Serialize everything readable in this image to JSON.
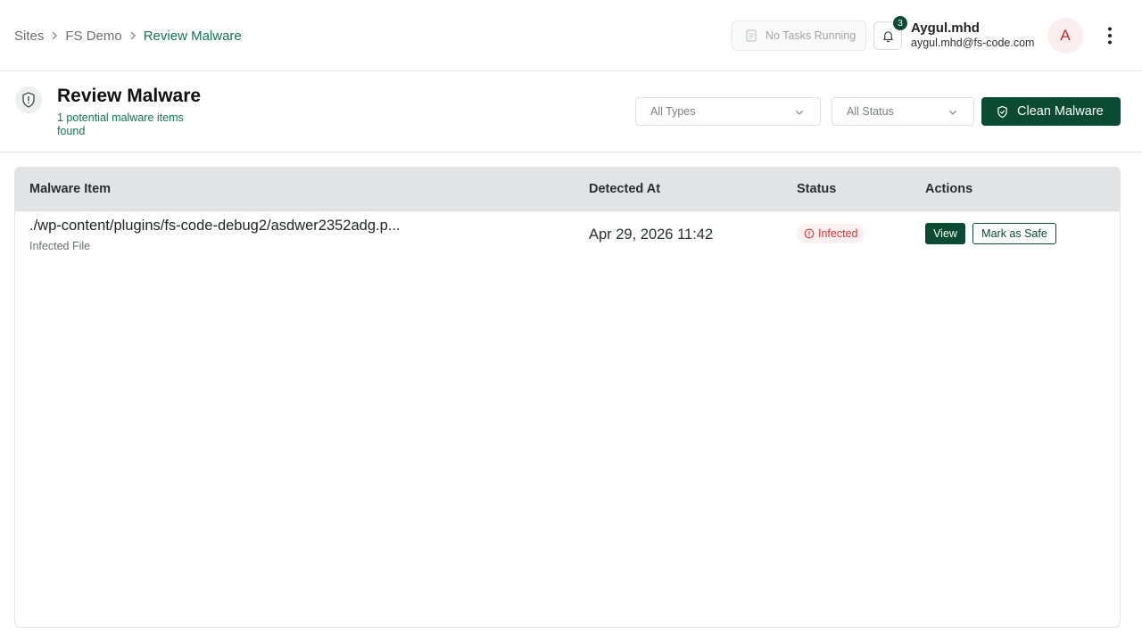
{
  "breadcrumb": {
    "items": [
      {
        "label": "Sites"
      },
      {
        "label": "FS Demo"
      },
      {
        "label": "Review Malware"
      }
    ]
  },
  "header": {
    "tasks_label": "No Tasks Running",
    "notification_count": "3",
    "user_name": "Aygul.mhd",
    "user_email": "aygul.mhd@fs-code.com",
    "avatar_initial": "A"
  },
  "page": {
    "title": "Review Malware",
    "subtitle": "1 potential malware items found",
    "type_filter": "All Types",
    "status_filter": "All Status",
    "clean_label": "Clean Malware"
  },
  "table": {
    "columns": [
      "Malware Item",
      "Detected At",
      "Status",
      "Actions"
    ],
    "rows": [
      {
        "path": "./wp-content/plugins/fs-code-debug2/asdwer2352adg.p...",
        "type": "Infected File",
        "detected_at": "Apr 29, 2026 11:42",
        "status": "Infected",
        "view_label": "View",
        "safe_label": "Mark as Safe"
      }
    ]
  },
  "colors": {
    "brand": "#0b4a33",
    "accent_text": "#14744f",
    "danger": "#d4353a"
  }
}
